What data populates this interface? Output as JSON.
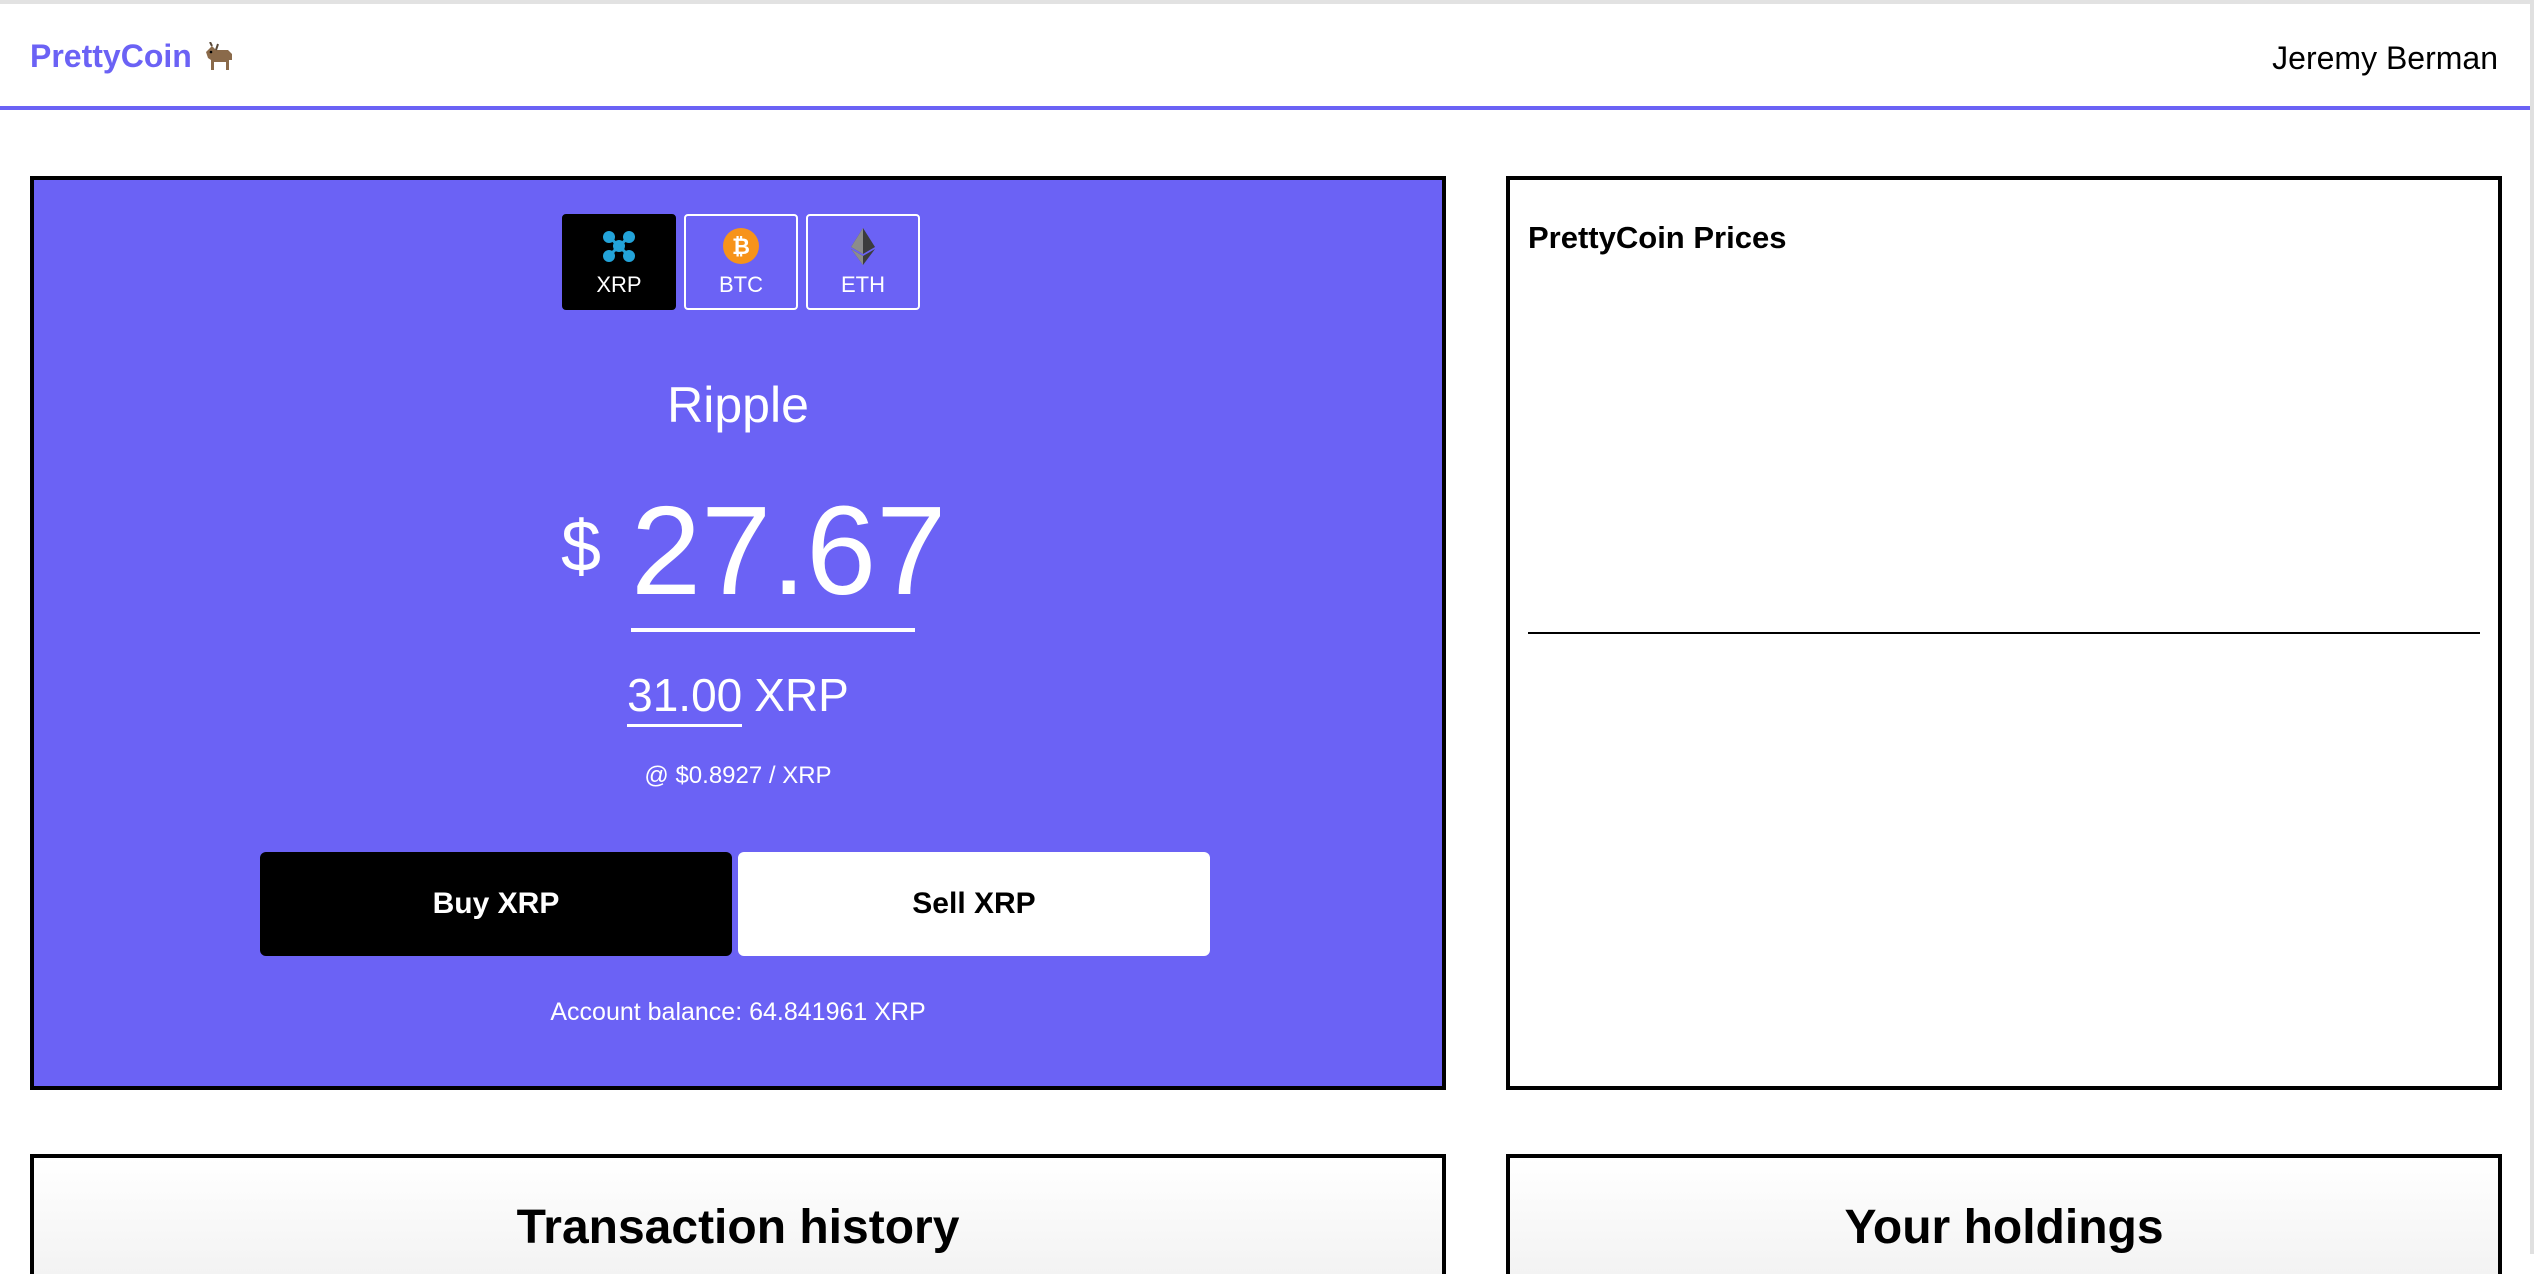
{
  "header": {
    "brand": "PrettyCoin",
    "brand_icon": "goat-icon",
    "user_name": "Jeremy Berman",
    "accent_color": "#6b62f5"
  },
  "trade": {
    "tabs": [
      {
        "label": "XRP",
        "icon": "xrp-icon",
        "active": true
      },
      {
        "label": "BTC",
        "icon": "btc-icon",
        "active": false
      },
      {
        "label": "ETH",
        "icon": "eth-icon",
        "active": false
      }
    ],
    "coin_name": "Ripple",
    "currency_symbol": "$",
    "usd_amount": "27.67",
    "quantity": "31.00",
    "quantity_unit": "XRP",
    "rate": "@ $0.8927 / XRP",
    "buy_label": "Buy XRP",
    "sell_label": "Sell XRP",
    "balance": "Account balance: 64.841961 XRP",
    "panel_color": "#6b62f5"
  },
  "prices": {
    "title": "PrettyCoin Prices"
  },
  "bottom": {
    "history_title": "Transaction history",
    "holdings_title": "Your holdings"
  }
}
